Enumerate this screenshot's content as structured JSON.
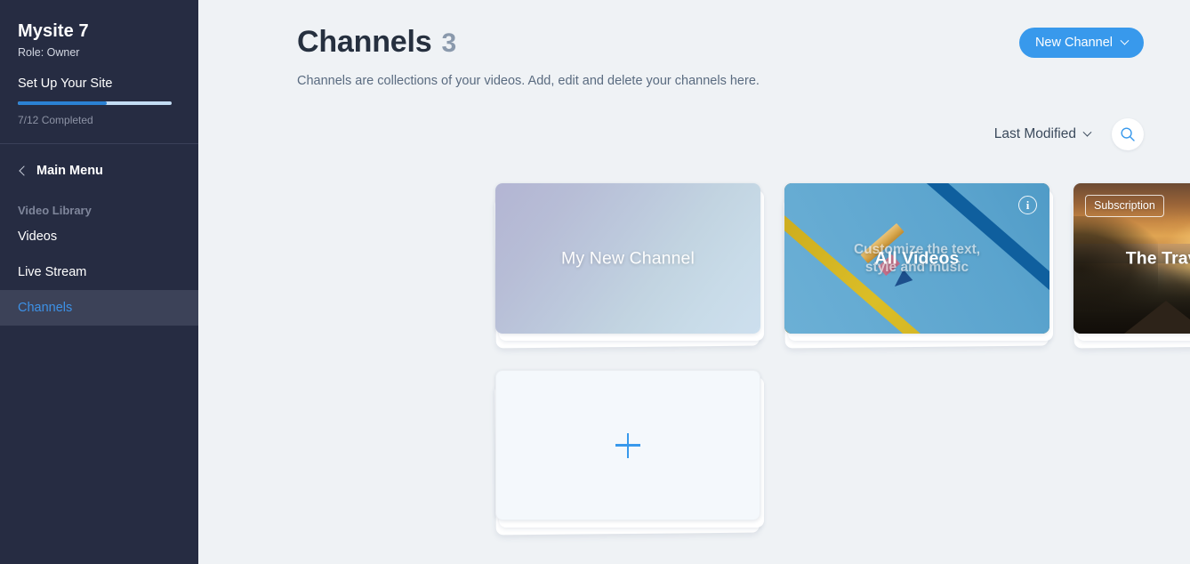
{
  "sidebar": {
    "site_title": "Mysite 7",
    "role": "Role: Owner",
    "setup": {
      "label": "Set Up Your Site",
      "progress_caption": "7/12 Completed",
      "completed": 7,
      "total": 12,
      "percent": 58,
      "fill_color": "#2b82d4",
      "track_color": "#c3dcf3"
    },
    "main_menu_label": "Main Menu",
    "section_title": "Video Library",
    "items": [
      {
        "label": "Videos",
        "active": false
      },
      {
        "label": "Live Stream",
        "active": false
      },
      {
        "label": "Channels",
        "active": true
      }
    ],
    "active_color": "#3d91e6",
    "background": "#262c42"
  },
  "header": {
    "title": "Channels",
    "count": "3",
    "subtitle": "Channels are collections of your videos. Add, edit and delete your channels here.",
    "new_channel_label": "New Channel",
    "new_channel_color": "#3899ec"
  },
  "toolbar": {
    "sort_label": "Last Modified",
    "search_icon": "search-icon",
    "sort_chevron_icon": "chevron-down-icon"
  },
  "cards": [
    {
      "title": "My New Channel",
      "media": "gradient",
      "badge": null,
      "media_caption": null,
      "info": false
    },
    {
      "title": "All Videos",
      "media": "pencil",
      "badge": null,
      "media_caption_line1": "Customize the text,",
      "media_caption_line2": "style and music",
      "info": true,
      "info_icon": "info-icon"
    },
    {
      "title": "The Travel Channel",
      "media": "sunset",
      "badge": "Subscription",
      "media_caption": null,
      "info": false
    }
  ],
  "add_card": {
    "icon": "plus-icon",
    "label": ""
  },
  "colors": {
    "page_background": "#eff2f5",
    "accent": "#3899ec",
    "title": "#26303f",
    "count": "#8a99ac",
    "subtitle": "#5a6b80"
  }
}
